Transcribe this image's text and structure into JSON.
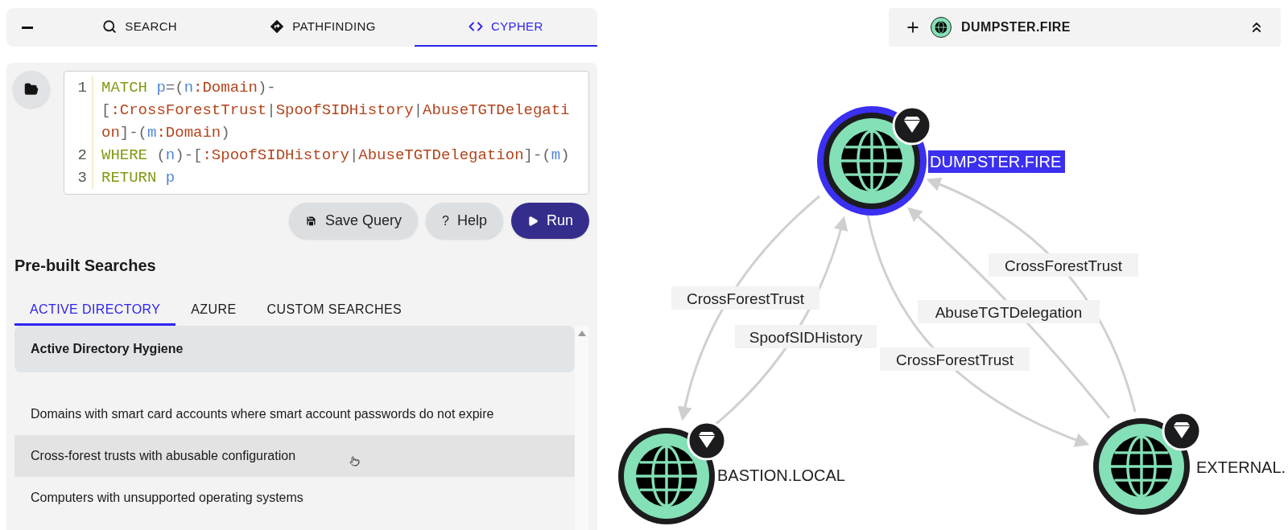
{
  "top_tabs": [
    {
      "label": "SEARCH",
      "selected": false
    },
    {
      "label": "PATHFINDING",
      "selected": false
    },
    {
      "label": "CYPHER",
      "selected": true
    }
  ],
  "editor": {
    "lines": [
      {
        "number": "1",
        "tokens": [
          {
            "kind": "keyword",
            "text": "MATCH "
          },
          {
            "kind": "variable",
            "text": "p"
          },
          {
            "kind": "punct",
            "text": "=("
          },
          {
            "kind": "variable",
            "text": "n"
          },
          {
            "kind": "label",
            "text": ":Domain"
          },
          {
            "kind": "punct",
            "text": ")-"
          },
          {
            "kind": "wrap"
          },
          {
            "kind": "punct",
            "text": "["
          },
          {
            "kind": "label",
            "text": ":CrossForestTrust"
          },
          {
            "kind": "punct",
            "text": "|"
          },
          {
            "kind": "label",
            "text": "SpoofSIDHistory"
          },
          {
            "kind": "punct",
            "text": "|"
          },
          {
            "kind": "label",
            "text": "AbuseTGTDelegati"
          },
          {
            "kind": "wrap"
          },
          {
            "kind": "label",
            "text": "on"
          },
          {
            "kind": "punct",
            "text": "]-("
          },
          {
            "kind": "variable",
            "text": "m"
          },
          {
            "kind": "label",
            "text": ":Domain"
          },
          {
            "kind": "punct",
            "text": ")"
          }
        ]
      },
      {
        "number": "2",
        "tokens": [
          {
            "kind": "keyword",
            "text": "WHERE "
          },
          {
            "kind": "punct",
            "text": "("
          },
          {
            "kind": "variable",
            "text": "n"
          },
          {
            "kind": "punct",
            "text": ")-["
          },
          {
            "kind": "label",
            "text": ":SpoofSIDHistory"
          },
          {
            "kind": "punct",
            "text": "|"
          },
          {
            "kind": "label",
            "text": "AbuseTGTDelegation"
          },
          {
            "kind": "punct",
            "text": "]-("
          },
          {
            "kind": "variable",
            "text": "m"
          },
          {
            "kind": "punct",
            "text": ")"
          }
        ]
      },
      {
        "number": "3",
        "tokens": [
          {
            "kind": "keyword",
            "text": "RETURN "
          },
          {
            "kind": "variable",
            "text": "p"
          }
        ]
      }
    ]
  },
  "buttons": [
    {
      "kind": "save",
      "label": "Save Query"
    },
    {
      "kind": "help",
      "glyph": "?",
      "label": "Help"
    },
    {
      "kind": "run",
      "label": "Run"
    }
  ],
  "prebuilt": {
    "title": "Pre-built Searches",
    "tabs": [
      {
        "label": "ACTIVE DIRECTORY",
        "selected": true
      },
      {
        "label": "AZURE",
        "selected": false
      },
      {
        "label": "CUSTOM SEARCHES",
        "selected": false
      }
    ],
    "group_header": "Active Directory Hygiene",
    "items": [
      {
        "label": "Domains with smart card accounts where smart account passwords do not expire",
        "highlighted": false
      },
      {
        "label": "Cross-forest trusts with abusable configuration",
        "highlighted": true
      },
      {
        "label": "Computers with unsupported operating systems",
        "highlighted": false
      }
    ]
  },
  "selected_node_bar": {
    "title": "DUMPSTER.FIRE"
  },
  "graph": {
    "nodes": [
      {
        "label": "DUMPSTER.FIRE",
        "selected": true
      },
      {
        "label": "BASTION.LOCAL",
        "selected": false
      },
      {
        "label": "EXTERNAL.",
        "selected": false
      }
    ],
    "edges": [
      {
        "label": "CrossForestTrust"
      },
      {
        "label": "SpoofSIDHistory"
      },
      {
        "label": "CrossForestTrust"
      },
      {
        "label": "AbuseTGTDelegation"
      },
      {
        "label": "CrossForestTrust"
      }
    ]
  }
}
